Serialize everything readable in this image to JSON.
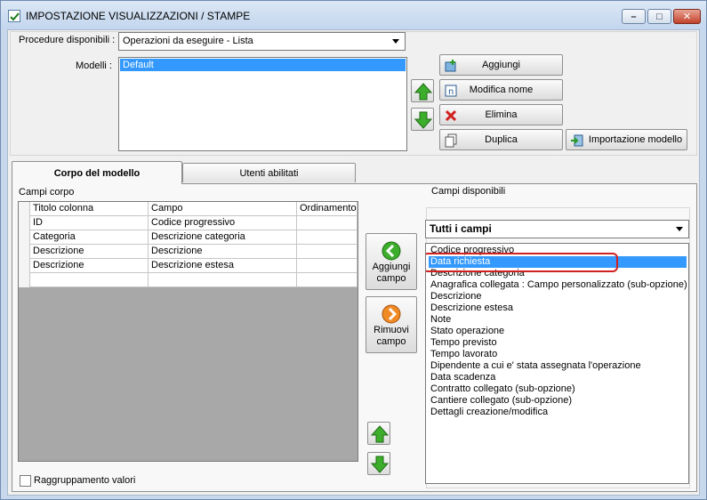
{
  "window": {
    "title": "IMPOSTAZIONE VISUALIZZAZIONI / STAMPE",
    "minimize": "–",
    "maximize": "□",
    "close": "✕"
  },
  "top": {
    "procedure_label": "Procedure disponibili :",
    "procedure_value": "Operazioni da eseguire - Lista",
    "modelli_label": "Modelli :",
    "modelli": [
      "Default"
    ],
    "buttons": {
      "aggiungi": "Aggiungi",
      "modifica_nome": "Modifica nome",
      "elimina": "Elimina",
      "duplica": "Duplica",
      "importazione": "Importazione modello"
    }
  },
  "tabs": [
    {
      "label": "Corpo del modello",
      "active": true
    },
    {
      "label": "Utenti abilitati",
      "active": false
    }
  ],
  "corpo": {
    "label": "Campi corpo",
    "columns": [
      "Titolo colonna",
      "Campo",
      "Ordinamento"
    ],
    "rows": [
      [
        "ID",
        "Codice progressivo",
        ""
      ],
      [
        "Categoria",
        "Descrizione categoria",
        ""
      ],
      [
        "Descrizione",
        "Descrizione",
        ""
      ],
      [
        "Descrizione",
        "Descrizione estesa",
        ""
      ],
      [
        "",
        "",
        ""
      ]
    ]
  },
  "middle_buttons": {
    "aggiungi_campo_1": "Aggiungi",
    "aggiungi_campo_2": "campo",
    "rimuovi_campo_1": "Rimuovi",
    "rimuovi_campo_2": "campo"
  },
  "disponibili": {
    "label": "Campi disponibili",
    "filter": "Tutti i campi",
    "items": [
      "Codice progressivo",
      "Data richiesta",
      "Descrizione categoria",
      "Anagrafica collegata : Campo personalizzato (sub-opzione)",
      "Descrizione",
      "Descrizione estesa",
      "Note",
      "Stato operazione",
      "Tempo previsto",
      "Tempo lavorato",
      "Dipendente a cui e' stata assegnata l'operazione",
      "Data scadenza",
      "Contratto collegato (sub-opzione)",
      "Cantiere collegato (sub-opzione)",
      "Dettagli creazione/modifica"
    ],
    "selected_index": 1
  },
  "raggruppamento": {
    "label": "Raggruppamento valori",
    "checked": false
  },
  "colors": {
    "selection": "#3399ff",
    "highlight": "#d02020",
    "arrow_green": "#3cae2c",
    "arrow_orange": "#f08a24"
  }
}
